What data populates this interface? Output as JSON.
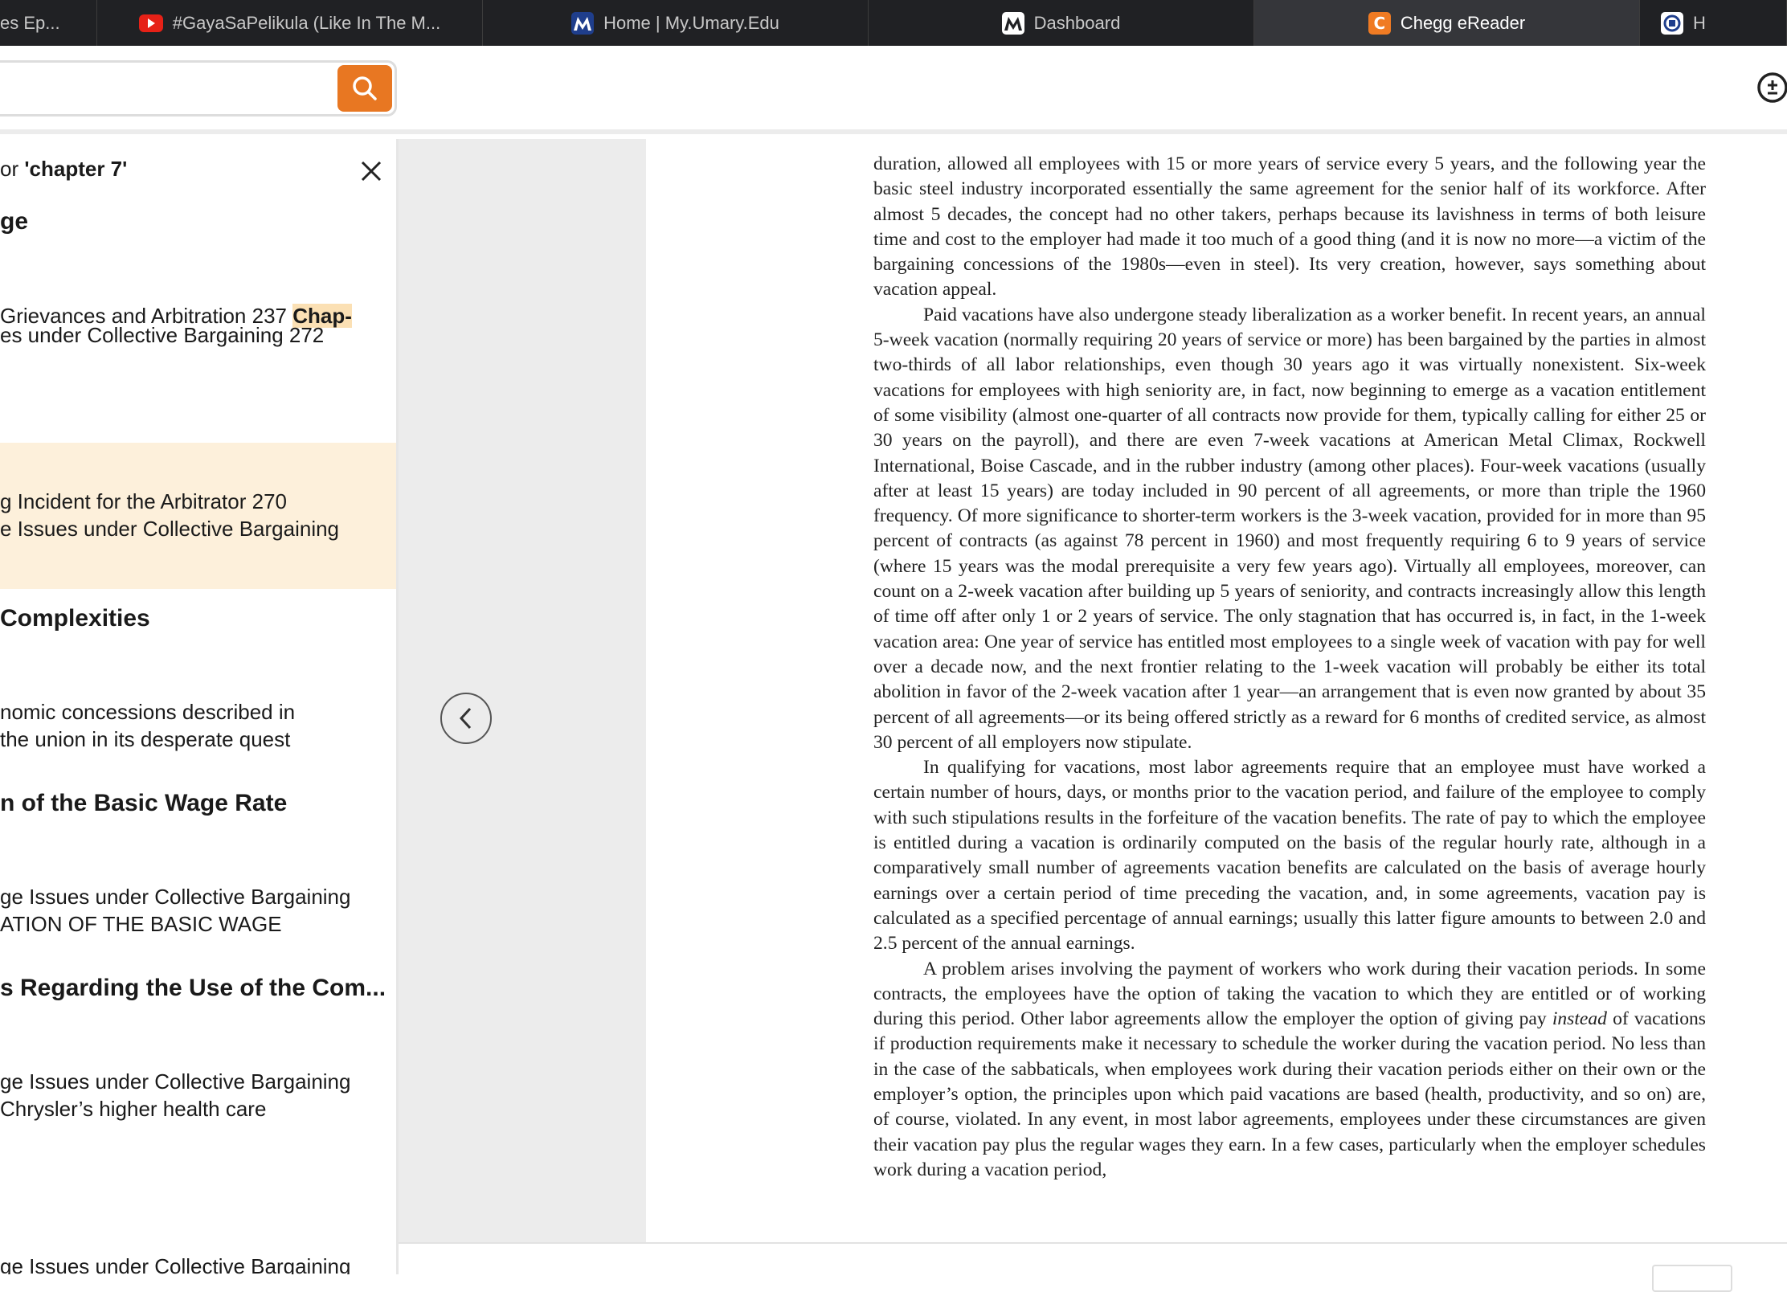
{
  "tabs": [
    {
      "label": "es Ep...",
      "icon": "none"
    },
    {
      "label": "#GayaSaPelikula (Like In The M...",
      "icon": "youtube-icon"
    },
    {
      "label": "Home | My.Umary.Edu",
      "icon": "umary-icon"
    },
    {
      "label": "Dashboard",
      "icon": "umary-icon"
    },
    {
      "label": "Chegg eReader",
      "icon": "chegg-icon",
      "active": true
    },
    {
      "label": "H",
      "icon": "globe-icon"
    }
  ],
  "search": {
    "value": "",
    "placeholder": ""
  },
  "sidebar": {
    "results_prefix": "or ",
    "results_query": "'chapter 7'",
    "entries": [
      {
        "heading": "ge"
      },
      {
        "line1": "Grievances and Arbitration 237 ",
        "line1_hl": "Chap-",
        "line2": "es under Collective Bargaining 272"
      },
      {
        "line1": "g Incident for the Arbitrator 270",
        "line2": "e Issues under Collective Bargaining"
      },
      {
        "heading": " Complexities"
      },
      {
        "line1": "nomic concessions described in",
        "line2": " the union in its desperate quest"
      },
      {
        "heading": "n of the Basic Wage Rate"
      },
      {
        "line1": "ge Issues under Collective Bargaining",
        "line2": "ATION OF THE BASIC WAGE"
      },
      {
        "heading": "s Regarding the Use of the Com..."
      },
      {
        "line1": "ge Issues under Collective Bargaining",
        "line2": " Chrysler’s higher health care"
      },
      {
        "line1": "ge Issues under Collective Bargaining"
      }
    ]
  },
  "page": {
    "p1": "duration, allowed all employees with 15 or more years of service every 5 years, and the following year the basic steel industry incorporated essentially the same agreement for the senior half of its workforce. After almost 5 decades, the concept had no other takers, perhaps because its lavishness in terms of both leisure time and cost to the employer had made it too much of a good thing (and it is now no more—a victim of the bargaining concessions of the 1980s—even in steel). Its very creation, however, says something about vacation appeal.",
    "p2": "Paid vacations have also undergone steady liberalization as a worker benefit. In recent years, an annual 5-week vacation (normally requiring 20 years of service or more) has been bargained by the parties in almost two-thirds of all labor relationships, even though 30 years ago it was virtually nonexistent. Six-week vacations for employees with high seniority are, in fact, now beginning to emerge as a vacation entitlement of some visibility (almost one-quarter of all contracts now provide for them, typically calling for either 25 or 30 years on the payroll), and there are even 7-week vacations at American Metal Climax, Rockwell International, Boise Cascade, and in the rubber industry (among other places). Four-week vacations (usually after at least 15 years) are today included in 90 percent of all agreements, or more than triple the 1960 frequency. Of more significance to shorter-term workers is the 3-week vacation, provided for in more than 95 percent of contracts (as against 78 percent in 1960) and most frequently requiring 6 to 9 years of service (where 15 years was the modal prerequisite a very few years ago). Virtually all employees, moreover, can count on a 2-week vacation after building up 5 years of seniority, and contracts increasingly allow this length of time off after only 1 or 2 years of service. The only stagnation that has occurred is, in fact, in the 1-week vacation area: One year of service has entitled most employees to a single week of vacation with pay for well over a decade now, and the next frontier relating to the 1-week vacation will probably be either its total abolition in favor of the 2-week vacation after 1 year—an arrangement that is even now granted by about 35 percent of all agreements—or its being offered strictly as a reward for 6 months of credited service, as almost 30 percent of all employers now stipulate.",
    "p3": "In qualifying for vacations, most labor agreements require that an employee must have worked a certain number of hours, days, or months prior to the vacation period, and failure of the employee to comply with such stipulations results in the forfeiture of the vacation benefits. The rate of pay to which the employee is entitled during a vacation is ordinarily computed on the basis of the regular hourly rate, although in a comparatively small number of agreements vacation benefits are calculated on the basis of average hourly earnings over a certain period of time preceding the vacation, and, in some agreements, vacation pay is calculated as a specified percentage of annual earnings; usually this latter figure amounts to between 2.0 and 2.5 percent of the annual earnings.",
    "p4_a": "A problem arises involving the payment of workers who work during their vacation periods. In some contracts, the employees have the option of taking the vacation to which they are entitled or of working during this period. Other labor agreements allow the employer the option of giving pay ",
    "p4_em": "instead",
    "p4_b": " of vacations if production requirements make it necessary to schedule the worker during the vacation period. No less than in the case of the sabbaticals, when employees work during their vacation periods either on their own or the employer’s option, the principles upon which paid vacations are based (health, productivity, and so on) are, of course, violated. In any event, in most labor agreements, employees under these circumstances are given their vacation pay plus the regular wages they earn. In a few cases, particularly when the employer schedules work during a vacation period,"
  }
}
